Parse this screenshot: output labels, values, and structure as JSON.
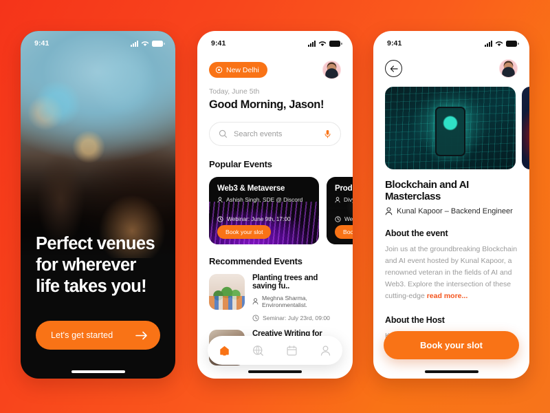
{
  "background": {
    "start_color": "#f5341a",
    "end_color": "#f7741b"
  },
  "accent_color": "#f97316",
  "phone1": {
    "status": {
      "time": "9:41"
    },
    "hero_title": "Perfect venues for wherever life takes you!",
    "cta_label": "Let's get started",
    "cta_icon": "arrow-right-icon"
  },
  "phone2": {
    "status": {
      "time": "9:41"
    },
    "location_pill": {
      "label": "New Delhi",
      "icon": "map-pin-icon"
    },
    "avatar": "user-avatar",
    "date_label": "Today, June 5th",
    "greeting": "Good Morning, Jason!",
    "search": {
      "placeholder": "Search events",
      "icon": "search-icon",
      "mic_icon": "microphone-icon"
    },
    "popular": {
      "title": "Popular Events",
      "cards": [
        {
          "title": "Web3 & Metaverse",
          "host": "Ashish Singh, SDE @ Discord",
          "when": "Webinar: June 9th, 17:00",
          "button": "Book your slot"
        },
        {
          "title": "Product De",
          "host": "Divya Meht",
          "when": "Webina",
          "button": "Book your s"
        }
      ]
    },
    "recommended": {
      "title": "Recommended Events",
      "items": [
        {
          "title": "Planting trees and saving fu..",
          "host": "Meghna Sharma, Environmentalist.",
          "when": "Seminar: July 23rd, 09:00"
        },
        {
          "title": "Creative Writing for Corpora..",
          "host": "",
          "when": ""
        }
      ]
    },
    "tabs": [
      {
        "name": "home",
        "icon": "home-icon",
        "active": true
      },
      {
        "name": "explore",
        "icon": "globe-search-icon",
        "active": false
      },
      {
        "name": "calendar",
        "icon": "calendar-icon",
        "active": false
      },
      {
        "name": "profile",
        "icon": "person-icon",
        "active": false
      }
    ]
  },
  "phone3": {
    "status": {
      "time": "9:41"
    },
    "back_icon": "arrow-left-icon",
    "avatar": "user-avatar",
    "title": "Blockchain and AI Masterclass",
    "host": "Kunal Kapoor – Backend Engineer",
    "about_event_heading": "About the event",
    "about_event_text": "Join us at the groundbreaking Blockchain and AI event hosted by Kunal Kapoor, a renowned veteran in the fields of AI and Web3. Explore the intersection of these cutting-edge ",
    "read_more": "read more...",
    "about_host_heading": "About the Host",
    "about_host_text": "Kunal Kapoor is an experienced back-end",
    "book_button": "Book your slot"
  }
}
